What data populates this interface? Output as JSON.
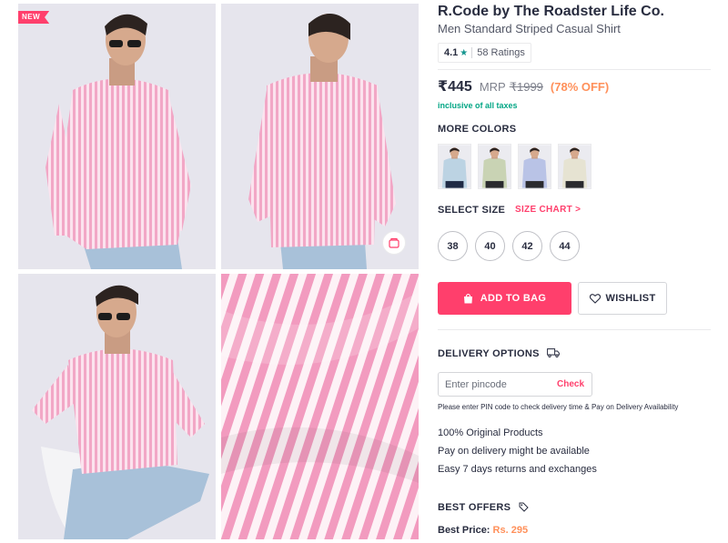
{
  "gallery": {
    "badge": "NEW",
    "images": [
      {
        "name": "model-front-photo"
      },
      {
        "name": "model-back-photo"
      },
      {
        "name": "model-seated-photo"
      },
      {
        "name": "fabric-closeup-photo"
      }
    ],
    "similar_icon": "similar-products-icon"
  },
  "product": {
    "brand": "R.Code by The Roadster Life Co.",
    "name": "Men Standard Striped Casual Shirt",
    "rating": {
      "value": "4.1",
      "star_icon": "star-icon",
      "count_text": "58 Ratings"
    },
    "price": {
      "selling": "₹445",
      "mrp_label": "MRP",
      "mrp": "₹1999",
      "discount": "(78% OFF)"
    },
    "tax_note": "inclusive of all taxes"
  },
  "colors": {
    "title": "MORE COLORS",
    "swatches": [
      {
        "name": "color-option-light-blue",
        "hex": "#bcd3e3"
      },
      {
        "name": "color-option-sage-green",
        "hex": "#c9d3b4"
      },
      {
        "name": "color-option-lavender",
        "hex": "#b9c3e6"
      },
      {
        "name": "color-option-cream",
        "hex": "#e6e3d2"
      }
    ]
  },
  "sizes": {
    "title": "SELECT SIZE",
    "chart_link": "SIZE CHART >",
    "options": [
      "38",
      "40",
      "42",
      "44"
    ]
  },
  "actions": {
    "add_to_bag": "ADD TO BAG",
    "wishlist": "WISHLIST"
  },
  "delivery": {
    "title": "DELIVERY OPTIONS",
    "pincode_placeholder": "Enter pincode",
    "check_label": "Check",
    "note": "Please enter PIN code to check delivery time & Pay on Delivery Availability",
    "bullets": [
      "100% Original Products",
      "Pay on delivery might be available",
      "Easy 7 days returns and exchanges"
    ]
  },
  "offers": {
    "title": "BEST OFFERS",
    "best_price_label": "Best Price:",
    "best_price_value": "Rs. 295"
  },
  "theme": {
    "accent": "#ff3f6c",
    "discount": "#ff905a",
    "rating_star": "#14958f",
    "shirt_pink": "#f2a7c6"
  }
}
